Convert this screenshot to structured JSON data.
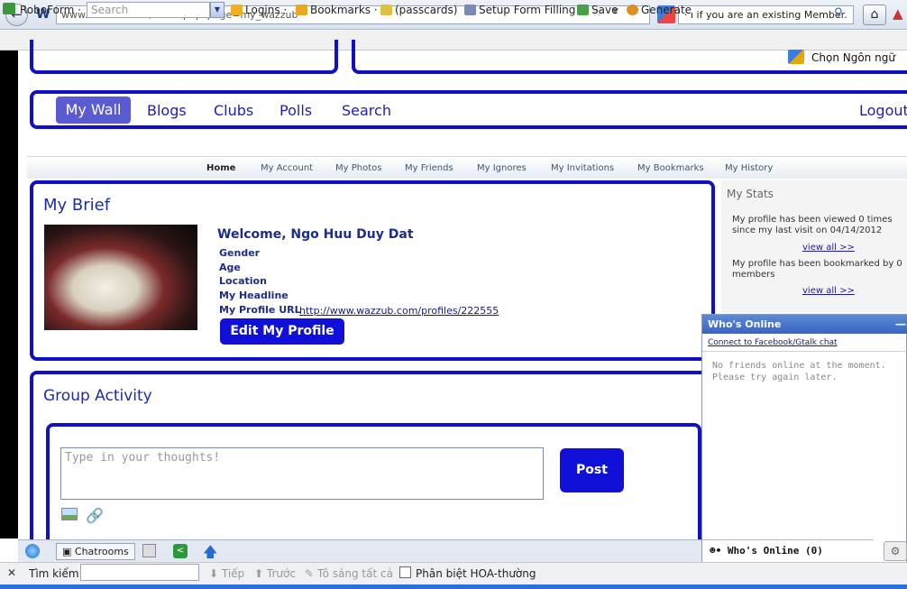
{
  "browser": {
    "url": "www.wazzub.com/index.php?page=my_wazzub",
    "search_text": "· ı if you are an existing Member.",
    "icons": {
      "back": "back-arrow-icon",
      "home": "home-icon",
      "search": "magnifier-icon"
    }
  },
  "roboform": {
    "name": "RoboForm ·",
    "search_placeholder": "Search",
    "items": [
      "Logins ·",
      "Bookmarks ·",
      "(passcards)",
      "Setup Form Filling",
      "Save",
      "Generate"
    ]
  },
  "language_selector": "Chọn Ngôn ngữ",
  "main_nav": {
    "items": [
      "My Wall",
      "Blogs",
      "Clubs",
      "Polls",
      "Search"
    ],
    "logout": "Logout"
  },
  "sub_nav": [
    "Home",
    "My Account",
    "My Photos",
    "My Friends",
    "My Ignores",
    "My Invitations",
    "My Bookmarks",
    "My History"
  ],
  "brief": {
    "title": "My Brief",
    "welcome": "Welcome, Ngo Huu Duy Dat",
    "fields": [
      "Gender",
      "Age",
      "Location",
      "My Headline",
      "My Profile URL"
    ],
    "profile_url": "http://www.wazzub.com/profiles/222555",
    "edit_button": "Edit My Profile"
  },
  "stats": {
    "title": "My Stats",
    "viewed_text": "My profile has been viewed 0 times since my last visit on 04/14/2012",
    "view_all_1": "view all >>",
    "bookmarked_text": "My profile has been bookmarked by 0 members",
    "view_all_2": "view all >>"
  },
  "group": {
    "title": "Group Activity",
    "thought_placeholder": "Type in your thoughts!",
    "post_button": "Post"
  },
  "online": {
    "header": "Who's Online",
    "minimize": "—",
    "connect_link": "Connect to Facebook/Gtalk chat",
    "empty_message": "No friends online at the moment. Please try again later.",
    "footer": "Who's Online (0)"
  },
  "chatbar": {
    "chatrooms": "Chatrooms"
  },
  "findbar": {
    "label": "Tìm kiếm:",
    "next": "Tiếp",
    "prev": "Trước",
    "highlight": "Tô sáng tất cả",
    "match_case": "Phân biệt HOA-thường"
  },
  "colors": {
    "brand_blue": "#1010c8",
    "button_blue": "#1010d8",
    "panel_header": "#3566c2"
  }
}
